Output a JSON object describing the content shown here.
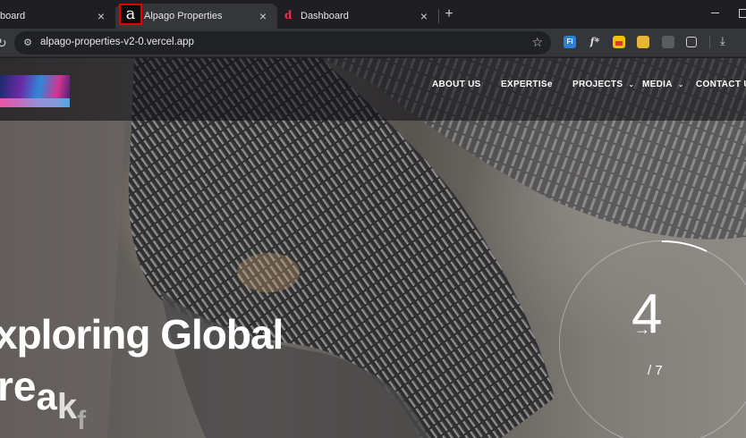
{
  "browser": {
    "tabs": [
      {
        "title": "board",
        "favicon": "dashboard-icon"
      },
      {
        "title": "Alpago Properties",
        "favicon": "alpago-a-icon",
        "favicon_glyph": "a",
        "active": true
      },
      {
        "title": "Dashboard",
        "favicon": "dashboard-d-icon",
        "favicon_glyph": "d"
      }
    ],
    "close_glyph": "×",
    "new_tab_glyph": "+",
    "url": "alpago-properties-v2-0.vercel.app",
    "bookmark_glyph": "☆",
    "ext_fi": "FI",
    "ext_fx": "f*",
    "download_glyph": "⤓",
    "reload_glyph": "↻",
    "site_info_glyph": "⚙"
  },
  "site": {
    "nav": [
      {
        "label": "ABOUT US",
        "dropdown": false
      },
      {
        "label": "EXPERTISe",
        "dropdown": false
      },
      {
        "label": "PROJECTS",
        "dropdown": true
      },
      {
        "label": "MEDIA",
        "dropdown": true
      },
      {
        "label": "CONTACT U",
        "dropdown": false
      }
    ],
    "chevron_glyph": "⌄",
    "hero": {
      "line1": "xploring Global",
      "line2_a": "re",
      "line2_b": "a",
      "line2_c": "k",
      "line2_d": "f"
    },
    "counter": {
      "current": "4",
      "arrow": "→",
      "total": "/ 7"
    }
  },
  "colors": {
    "tab_bg": "#1f1f23",
    "active_tab": "#35363a",
    "highlight_box": "#e00000"
  }
}
